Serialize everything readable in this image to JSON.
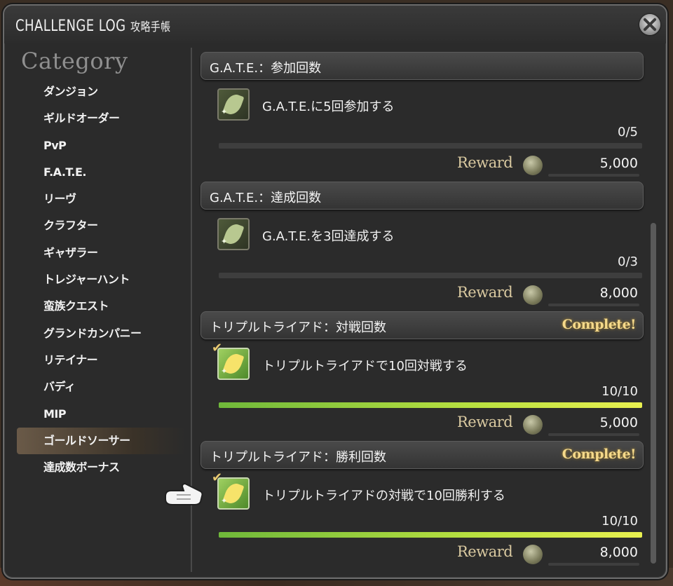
{
  "window": {
    "title": "CHALLENGE LOG",
    "title_jp": "攻略手帳"
  },
  "sidebar": {
    "heading": "Category",
    "items": [
      {
        "label": "ダンジョン"
      },
      {
        "label": "ギルドオーダー"
      },
      {
        "label": "PvP"
      },
      {
        "label": "F.A.T.E."
      },
      {
        "label": "リーヴ"
      },
      {
        "label": "クラフター"
      },
      {
        "label": "ギャザラー"
      },
      {
        "label": "トレジャーハント"
      },
      {
        "label": "蛮族クエスト"
      },
      {
        "label": "グランドカンパニー"
      },
      {
        "label": "リテイナー"
      },
      {
        "label": "バディ"
      },
      {
        "label": "MIP"
      },
      {
        "label": "ゴールドソーサー"
      },
      {
        "label": "達成数ボーナス"
      }
    ],
    "selected_index": 13
  },
  "sections": [
    {
      "title": "G.A.T.E.：参加回数",
      "complete_label": "",
      "task": "G.A.T.E.に5回参加する",
      "progress": "0/5",
      "progress_fraction": 0,
      "reward_label": "Reward",
      "reward_amount": "5,000",
      "done": false
    },
    {
      "title": "G.A.T.E.：達成回数",
      "complete_label": "",
      "task": "G.A.T.E.を3回達成する",
      "progress": "0/3",
      "progress_fraction": 0,
      "reward_label": "Reward",
      "reward_amount": "8,000",
      "done": false
    },
    {
      "title": "トリプルトライアド：対戦回数",
      "complete_label": "Complete!",
      "task": "トリプルトライアドで10回対戦する",
      "progress": "10/10",
      "progress_fraction": 1,
      "reward_label": "Reward",
      "reward_amount": "5,000",
      "done": true
    },
    {
      "title": "トリプルトライアド：勝利回数",
      "complete_label": "Complete!",
      "task": "トリプルトライアドの対戦で10回勝利する",
      "progress": "10/10",
      "progress_fraction": 1,
      "reward_label": "Reward",
      "reward_amount": "8,000",
      "done": true
    }
  ],
  "icons": {
    "close": "close-icon",
    "task": "leaf-icon",
    "coin": "gil-coin-icon",
    "pointer": "hand-pointer-icon",
    "check": "checkmark-icon"
  },
  "colors": {
    "complete_gold": "#f5d98a",
    "progress_green": "#b8e040",
    "selected_item": "#6a5a48"
  }
}
